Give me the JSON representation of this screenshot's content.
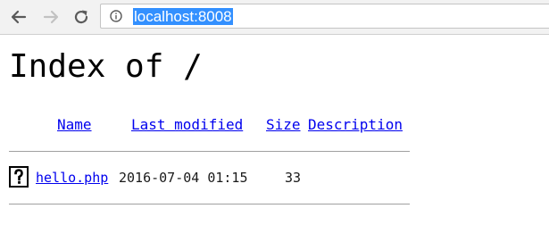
{
  "browser": {
    "url": "localhost:8008",
    "icons": {
      "back": "back-arrow-icon",
      "forward": "forward-arrow-icon",
      "reload": "reload-icon",
      "site_info": "info-icon"
    },
    "selection_color": "#3390ff"
  },
  "page": {
    "title": "Index of /",
    "columns": {
      "name": "Name",
      "last_modified": "Last modified",
      "size": "Size",
      "description": "Description"
    },
    "rows": [
      {
        "icon": "unknown-file-icon",
        "name": "hello.php",
        "last_modified": "2016-07-04 01:15",
        "size": "33",
        "description": ""
      }
    ],
    "link_color": "#0000ee"
  }
}
